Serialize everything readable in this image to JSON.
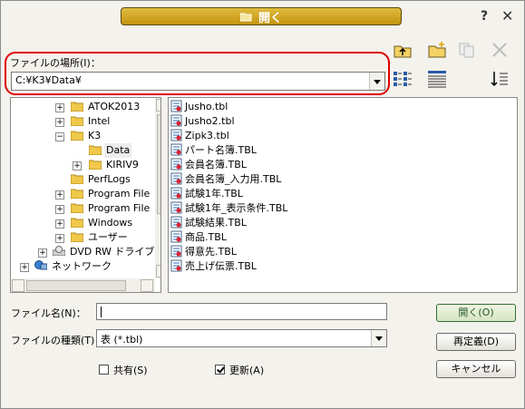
{
  "window": {
    "title": "開く"
  },
  "titlebar": {
    "help_glyph": "?",
    "close_glyph": "✕"
  },
  "location": {
    "label": "ファイルの場所(I)：",
    "value": "C:¥K3¥Data¥"
  },
  "tree": {
    "items": [
      {
        "label": "ATOK2013",
        "expander": "+"
      },
      {
        "label": "Intel",
        "expander": "+"
      },
      {
        "label": "K3",
        "expander": "−"
      },
      {
        "label": "Data",
        "expander": ""
      },
      {
        "label": "KIRIV9",
        "expander": "+"
      },
      {
        "label": "PerfLogs",
        "expander": ""
      },
      {
        "label": "Program File",
        "expander": "+"
      },
      {
        "label": "Program File",
        "expander": "+"
      },
      {
        "label": "Windows",
        "expander": "+"
      },
      {
        "label": "ユーザー",
        "expander": "+"
      },
      {
        "label": "DVD RW ドライブ",
        "expander": "+"
      },
      {
        "label": "ネットワーク",
        "expander": "+"
      }
    ]
  },
  "files": [
    "Jusho.tbl",
    "Jusho2.tbl",
    "Zipk3.tbl",
    "パート名簿.TBL",
    "会員名簿.TBL",
    "会員名簿_入力用.TBL",
    "試験1年.TBL",
    "試験1年_表示条件.TBL",
    "試験結果.TBL",
    "商品.TBL",
    "得意先.TBL",
    "売上げ伝票.TBL"
  ],
  "form": {
    "filename_label": "ファイル名(N)：",
    "filename_value": "",
    "filetype_label": "ファイルの種類(T)：",
    "filetype_value": "表 (*.tbl)",
    "shared_label": "共有(S)",
    "shared_checked": false,
    "update_label": "更新(A)",
    "update_checked": true
  },
  "buttons": {
    "open": "開く(O)",
    "redefine": "再定義(D)",
    "cancel": "キャンセル"
  },
  "colors": {
    "title_gold": "#c9a02a",
    "highlight_red": "#e00000",
    "folder_yellow": "#f0c84a"
  }
}
